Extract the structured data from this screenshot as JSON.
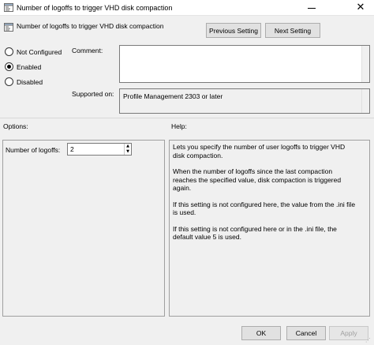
{
  "window": {
    "title": "Number of logoffs to trigger VHD disk compaction",
    "close_glyph": "✕"
  },
  "header": {
    "title": "Number of logoffs to trigger VHD disk compaction",
    "prev_label": "Previous Setting",
    "next_label": "Next Setting"
  },
  "state": {
    "options": [
      "Not Configured",
      "Enabled",
      "Disabled"
    ],
    "selected": "Enabled"
  },
  "comment": {
    "label": "Comment:",
    "value": ""
  },
  "supported": {
    "label": "Supported on:",
    "value": "Profile Management 2303 or later"
  },
  "options_section": {
    "label": "Options:",
    "field_label": "Number of logoffs:",
    "field_value": "2"
  },
  "help_section": {
    "label": "Help:",
    "paragraphs": [
      "Lets you specify the number of user logoffs to trigger VHD disk compaction.",
      "When the number of logoffs since the last compaction reaches the specified value, disk compaction is triggered again.",
      "If this setting is not configured here, the value from the .ini file is used.",
      "If this setting is not configured here or in the .ini file, the default value 5 is used."
    ]
  },
  "footer": {
    "ok_label": "OK",
    "cancel_label": "Cancel",
    "apply_label": "Apply"
  },
  "icons": {
    "app": "policy-setting-icon",
    "header": "policy-setting-icon"
  }
}
